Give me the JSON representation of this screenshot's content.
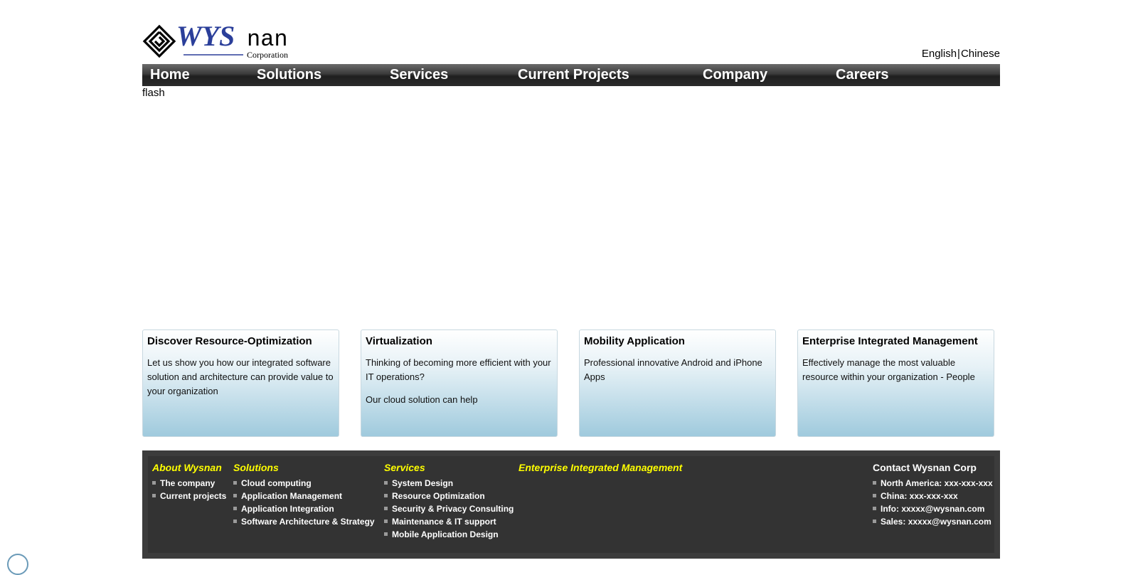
{
  "header": {
    "logo": {
      "brand": "WYSnan",
      "brand_part1": "WYS",
      "brand_part2": "nan",
      "subtitle": "Corporation"
    },
    "language": {
      "english": "English",
      "separator": "|",
      "chinese": "Chinese"
    }
  },
  "nav": {
    "items": [
      {
        "label": "Home"
      },
      {
        "label": "Solutions"
      },
      {
        "label": "Services"
      },
      {
        "label": "Current Projects"
      },
      {
        "label": "Company"
      },
      {
        "label": "Careers"
      }
    ]
  },
  "flash": {
    "label": "flash"
  },
  "boxes": [
    {
      "title": "Discover Resource-Optimization",
      "paragraphs": [
        "Let us show you how our integrated software solution and architecture can provide value to your organization"
      ]
    },
    {
      "title": "Virtualization",
      "paragraphs": [
        "Thinking of becoming more efficient with your IT operations?",
        "Our cloud solution can help"
      ]
    },
    {
      "title": "Mobility Application",
      "paragraphs": [
        "Professional innovative Android and iPhone Apps"
      ]
    },
    {
      "title": "Enterprise Integrated Management",
      "paragraphs": [
        "Effectively manage the most valuable resource within your organization - People"
      ]
    }
  ],
  "footer": {
    "about": {
      "heading": "About Wysnan",
      "links": [
        "The company",
        "Current projects"
      ]
    },
    "solutions": {
      "heading": "Solutions",
      "links": [
        "Cloud computing",
        "Application Management",
        "Application Integration",
        "Software Architecture & Strategy"
      ]
    },
    "services": {
      "heading": "Services",
      "links": [
        "System Design",
        "Resource Optimization",
        "Security & Privacy Consulting",
        "Maintenance & IT support",
        "Mobile Application Design"
      ]
    },
    "enterprise": {
      "heading": "Enterprise Integrated Management"
    },
    "contact": {
      "heading": "Contact Wysnan Corp",
      "lines": [
        "North America: xxx-xxx-xxx",
        "China: xxx-xxx-xxx",
        "Info: xxxxx@wysnan.com",
        "Sales: xxxxx@wysnan.com"
      ]
    }
  },
  "colors": {
    "footer_heading": "#ffff00",
    "logo_blue": "#2b3f9a",
    "nav_dark": "#2b2b2b"
  }
}
